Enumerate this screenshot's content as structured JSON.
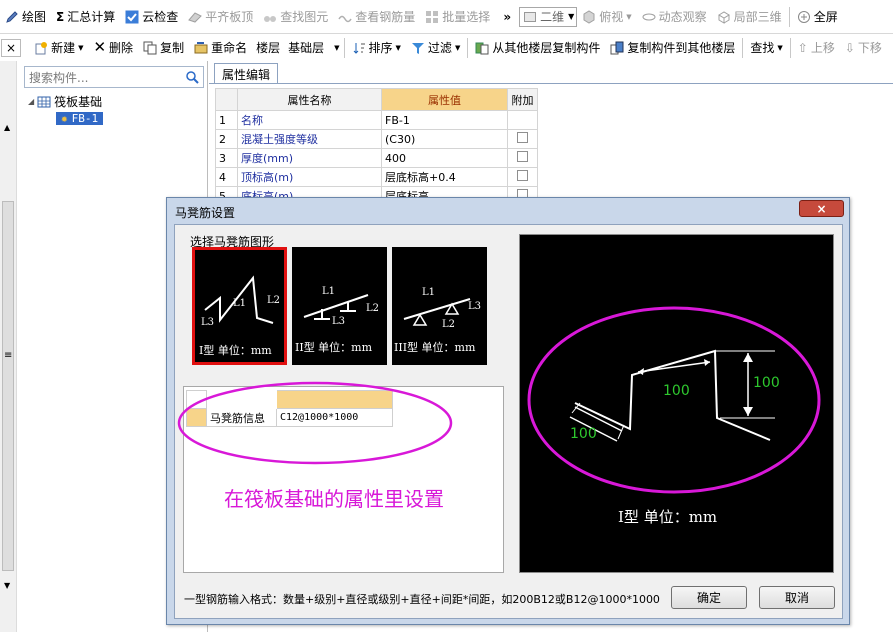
{
  "toolbar1": {
    "draw": "绘图",
    "sum_icon": "Σ",
    "sum_calc": "汇总计算",
    "cloud_check": "云检查",
    "flat_slab_top": "平齐板顶",
    "find_element": "查找图元",
    "view_rebar": "查看钢筋量",
    "batch_select": "批量选择",
    "more": "»",
    "view_mode": "二维",
    "top_view": "俯视",
    "dynamic_view": "动态观察",
    "local_3d": "局部三维",
    "fullscreen": "全屏"
  },
  "toolbar2": {
    "close": "×",
    "new": "新建",
    "delete": "删除",
    "copy": "复制",
    "rename": "重命名",
    "floor_label": "楼层",
    "floor_value": "基础层",
    "sort": "排序",
    "filter": "过滤",
    "copy_from_other": "从其他楼层复制构件",
    "copy_to_other": "复制构件到其他楼层",
    "find": "查找",
    "move_up": "上移",
    "move_down": "下移"
  },
  "left_panel": {
    "search_placeholder": "搜索构件...",
    "tree_root": "筏板基础",
    "tree_child": "FB-1",
    "scroll_mark": "≡"
  },
  "property_panel": {
    "tab": "属性编辑",
    "headers": {
      "name": "属性名称",
      "value": "属性值",
      "extra": "附加"
    },
    "rows": [
      {
        "idx": "1",
        "name": "名称",
        "value": "FB-1",
        "has_check": false
      },
      {
        "idx": "2",
        "name": "混凝土强度等级",
        "value": "(C30)",
        "has_check": true
      },
      {
        "idx": "3",
        "name": "厚度(mm)",
        "value": "400",
        "has_check": true
      },
      {
        "idx": "4",
        "name": "顶标高(m)",
        "value": "层底标高+0.4",
        "has_check": true
      },
      {
        "idx": "5",
        "name": "底标高(m)",
        "value": "层底标高",
        "has_check": true
      }
    ]
  },
  "dialog": {
    "title": "马凳筋设置",
    "close": "×",
    "select_label": "选择马凳筋图形",
    "shapes": [
      {
        "name": "I型",
        "caption": "I型 单位：mm",
        "labels": [
          "L1",
          "L2",
          "L3"
        ]
      },
      {
        "name": "II型",
        "caption": "II型 单位：mm",
        "labels": [
          "L1",
          "L2",
          "L3"
        ]
      },
      {
        "name": "III型",
        "caption": "III型 单位：mm",
        "labels": [
          "L1",
          "L2",
          "L3"
        ]
      }
    ],
    "info_label": "马凳筋信息",
    "info_value": "C12@1000*1000",
    "annotation": "在筏板基础的属性里设置",
    "preview": {
      "dims": [
        "100",
        "100",
        "100"
      ],
      "caption": "I型 单位：mm"
    },
    "hint": "一型钢筋输入格式：数量+级别+直径或级别+直径+间距*间距，如200B12或B12@1000*1000",
    "ok": "确定",
    "cancel": "取消"
  },
  "colors": {
    "annotation": "#d818d8",
    "header_value": "#f7d48a",
    "selection": "#3169c6",
    "dim_text": "#2ec82e",
    "active_shape_border": "#e01010"
  }
}
